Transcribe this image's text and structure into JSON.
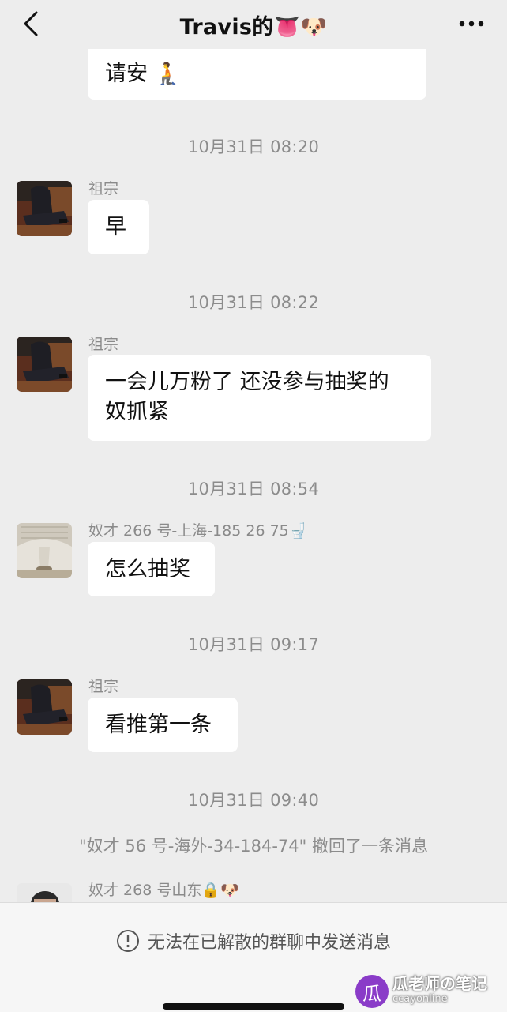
{
  "header": {
    "title": "Travis的👅🐶",
    "back_icon": "chevron-left-icon",
    "more_icon": "more-dots-icon"
  },
  "messages": {
    "top_partial": {
      "text": "请安 🧎"
    },
    "ts1": "10月31日 08:20",
    "m1": {
      "sender": "祖宗",
      "text": "早"
    },
    "ts2": "10月31日 08:22",
    "m2": {
      "sender": "祖宗",
      "line1": "一会儿万粉了 还没参与抽奖的",
      "line2": "奴抓紧"
    },
    "ts3": "10月31日 08:54",
    "m3": {
      "sender": "奴才 266 号-上海-185 26 75🚽",
      "text": "怎么抽奖"
    },
    "ts4": "10月31日 09:17",
    "m4": {
      "sender": "祖宗",
      "text": "看推第一条"
    },
    "ts5": "10月31日 09:40",
    "recall": "\"奴才 56 号-海外-34-184-74\" 撤回了一条消息",
    "m5": {
      "sender": "奴才 268 号山东🔒🐶"
    }
  },
  "footer": {
    "notice": "无法在已解散的群聊中发送消息",
    "notice_icon": "alert-circle-icon"
  },
  "watermark": {
    "logo_char": "瓜",
    "text": "瓜老师の笔记",
    "sub": "ccayonline"
  },
  "colors": {
    "background": "#ededed",
    "bubble": "#ffffff",
    "timestamp": "#8c8c8c"
  }
}
